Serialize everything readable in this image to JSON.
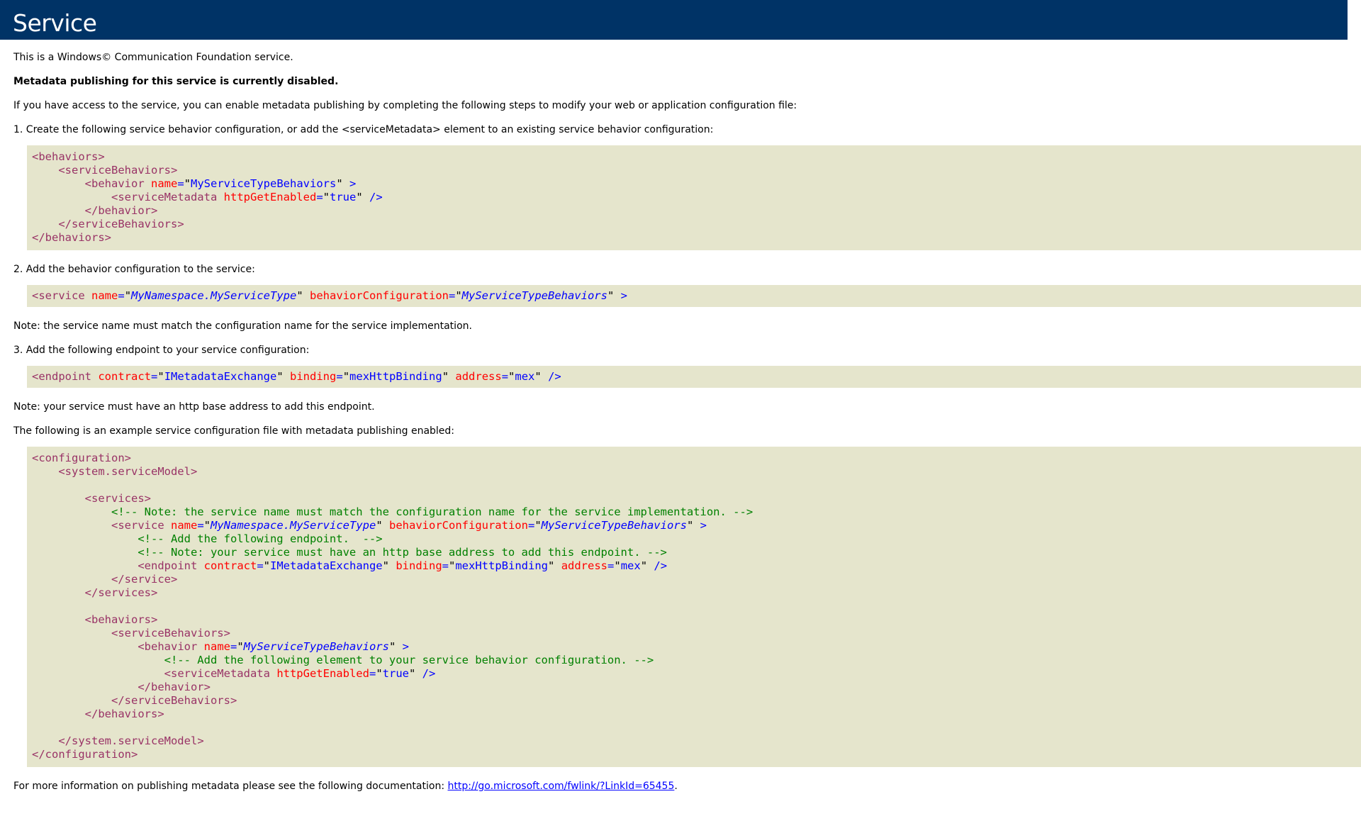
{
  "header": {
    "title": "Service"
  },
  "body": {
    "intro": "This is a Windows© Communication Foundation service.",
    "disabled_notice": "Metadata publishing for this service is currently disabled.",
    "instructions": "If you have access to the service, you can enable metadata publishing by completing the following steps to modify your web or application configuration file:",
    "step1": "1. Create the following service behavior configuration, or add the <serviceMetadata> element to an existing service behavior configuration:",
    "step2": "2. Add the behavior configuration to the service:",
    "note_service_name": "Note: the service name must match the configuration name for the service implementation.",
    "step3": "3. Add the following endpoint to your service configuration:",
    "note_base_address": "Note: your service must have an http base address to add this endpoint.",
    "example_intro": "The following is an example service configuration file with metadata publishing enabled:",
    "footer_text": "For more information on publishing metadata please see the following documentation: ",
    "footer_link": "http://go.microsoft.com/fwlink/?LinkId=65455",
    "footer_period": "."
  },
  "code": {
    "behaviors": "behaviors",
    "serviceBehaviors": "serviceBehaviors",
    "behavior": "behavior",
    "service": "service",
    "services": "services",
    "serviceMetadata": "serviceMetadata",
    "endpoint": "endpoint",
    "configuration": "configuration",
    "systemServiceModel": "system.serviceModel",
    "attr_name": "name",
    "attr_httpGetEnabled": "httpGetEnabled",
    "attr_behaviorConfiguration": "behaviorConfiguration",
    "attr_contract": "contract",
    "attr_binding": "binding",
    "attr_address": "address",
    "val_behaviors_name": "MyServiceTypeBehaviors",
    "val_true": "true",
    "val_service_name": "MyNamespace.MyServiceType",
    "val_contract": "IMetadataExchange",
    "val_binding": "mexHttpBinding",
    "val_address": "mex",
    "comment1": "<!-- Note: the service name must match the configuration name for the service implementation. -->",
    "comment2": "<!-- Add the following endpoint.  -->",
    "comment3": "<!-- Note: your service must have an http base address to add this endpoint. -->",
    "comment4": "<!-- Add the following element to your service behavior configuration. -->"
  }
}
